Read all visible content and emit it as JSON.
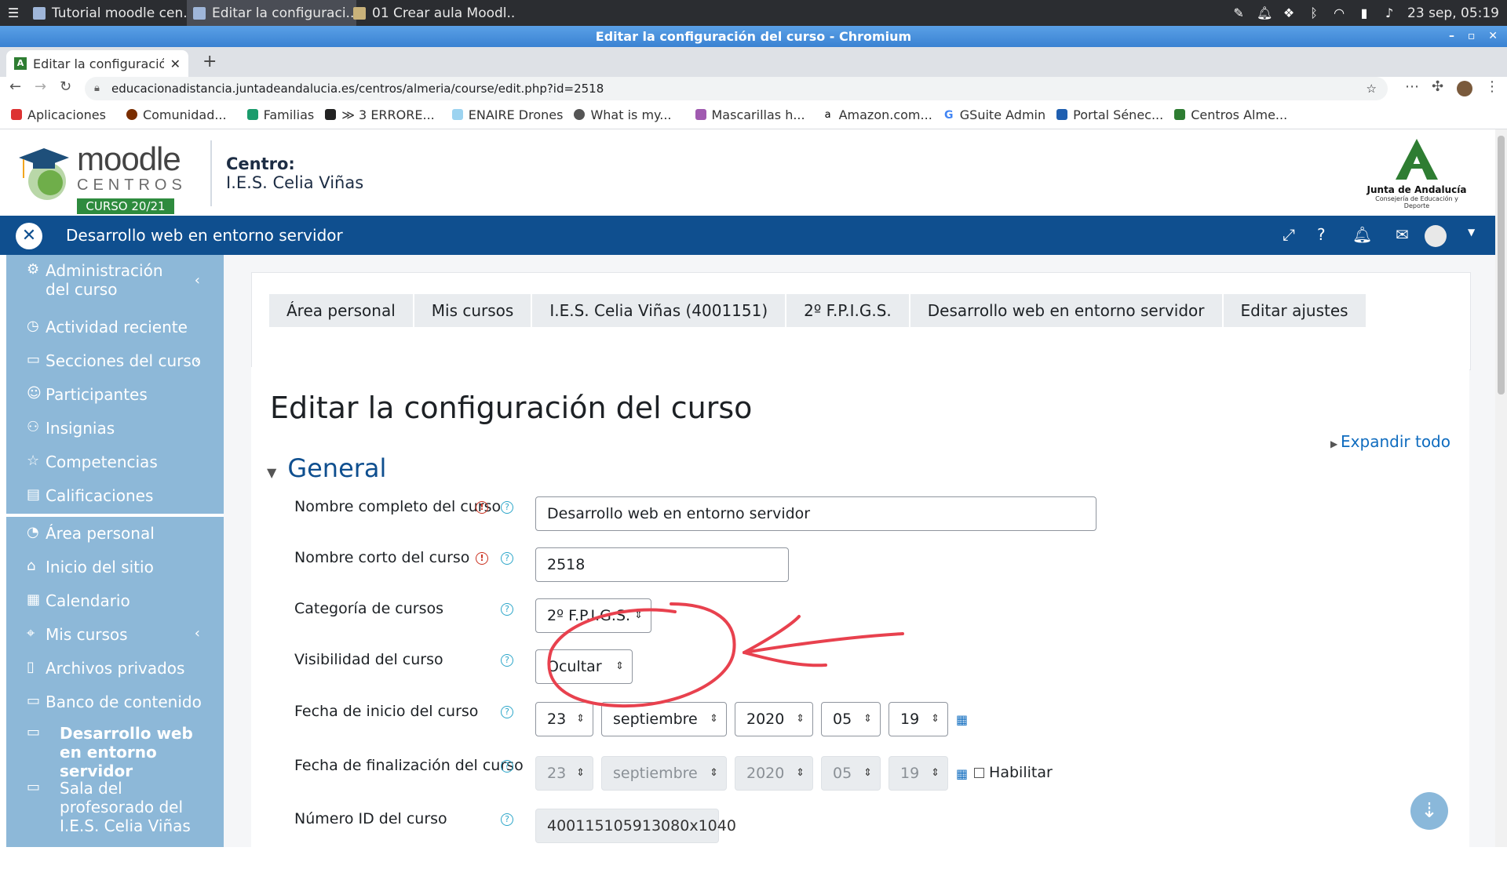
{
  "taskbar": {
    "tasks": [
      "Tutorial moodle cen...",
      "Editar la configuraci...",
      "01 Crear aula Moodl..."
    ],
    "datetime": "23 sep, 05:19"
  },
  "window": {
    "title": "Editar la configuración del curso - Chromium"
  },
  "browser": {
    "tab_title": "Editar la configuración",
    "url": "educacionadistancia.juntadeandalucia.es/centros/almeria/course/edit.php?id=2518",
    "bookmarks": [
      "Aplicaciones",
      "Comunidad...",
      "Familias",
      "≫ 3 ERRORE...",
      "ENAIRE Drones",
      "What is my...",
      "Mascarillas h...",
      "Amazon.com...",
      "GSuite Admin",
      "Portal Sénec...",
      "Centros Alme..."
    ]
  },
  "header": {
    "logo_moodle": "moodle",
    "logo_centros": "CENTROS",
    "logo_curso": "CURSO 20/21",
    "centro_label": "Centro:",
    "centro_name": "I.E.S. Celia Viñas",
    "junta_title": "Junta de Andalucía",
    "junta_sub": "Consejería de Educación y Deporte"
  },
  "navbar": {
    "course_title": "Desarrollo web en entorno servidor"
  },
  "sidebar": {
    "items": [
      "Administración del curso",
      "Actividad reciente",
      "Secciones del curso",
      "Participantes",
      "Insignias",
      "Competencias",
      "Calificaciones",
      "Área personal",
      "Inicio del sitio",
      "Calendario",
      "Mis cursos",
      "Archivos privados",
      "Banco de contenido",
      "Desarrollo web en entorno servidor",
      "Sala del profesorado del I.E.S. Celia Viñas"
    ]
  },
  "breadcrumb": [
    "Área personal",
    "Mis cursos",
    "I.E.S. Celia Viñas (4001151)",
    "2º F.P.I.G.S.",
    "Desarrollo web en entorno servidor",
    "Editar ajustes"
  ],
  "page": {
    "title": "Editar la configuración del curso",
    "expand_all": "Expandir todo",
    "section": "General"
  },
  "form": {
    "fullname_label": "Nombre completo del curso",
    "fullname_value": "Desarrollo web en entorno servidor",
    "shortname_label": "Nombre corto del curso",
    "shortname_value": "2518",
    "category_label": "Categoría de cursos",
    "category_value": "2º F.P.I.G.S.",
    "visibility_label": "Visibilidad del curso",
    "visibility_value": "Ocultar",
    "startdate_label": "Fecha de inicio del curso",
    "enddate_label": "Fecha de finalización del curso",
    "date_day": "23",
    "date_month": "septiembre",
    "date_year": "2020",
    "date_hour": "05",
    "date_min": "19",
    "enable_label": "Habilitar",
    "idnumber_label": "Número ID del curso",
    "idnumber_value": "400115105913080x1040"
  },
  "colors": {
    "nav_blue": "#0f4f8f",
    "sidebar": "#8db8d8",
    "annotation": "#e8414e"
  }
}
